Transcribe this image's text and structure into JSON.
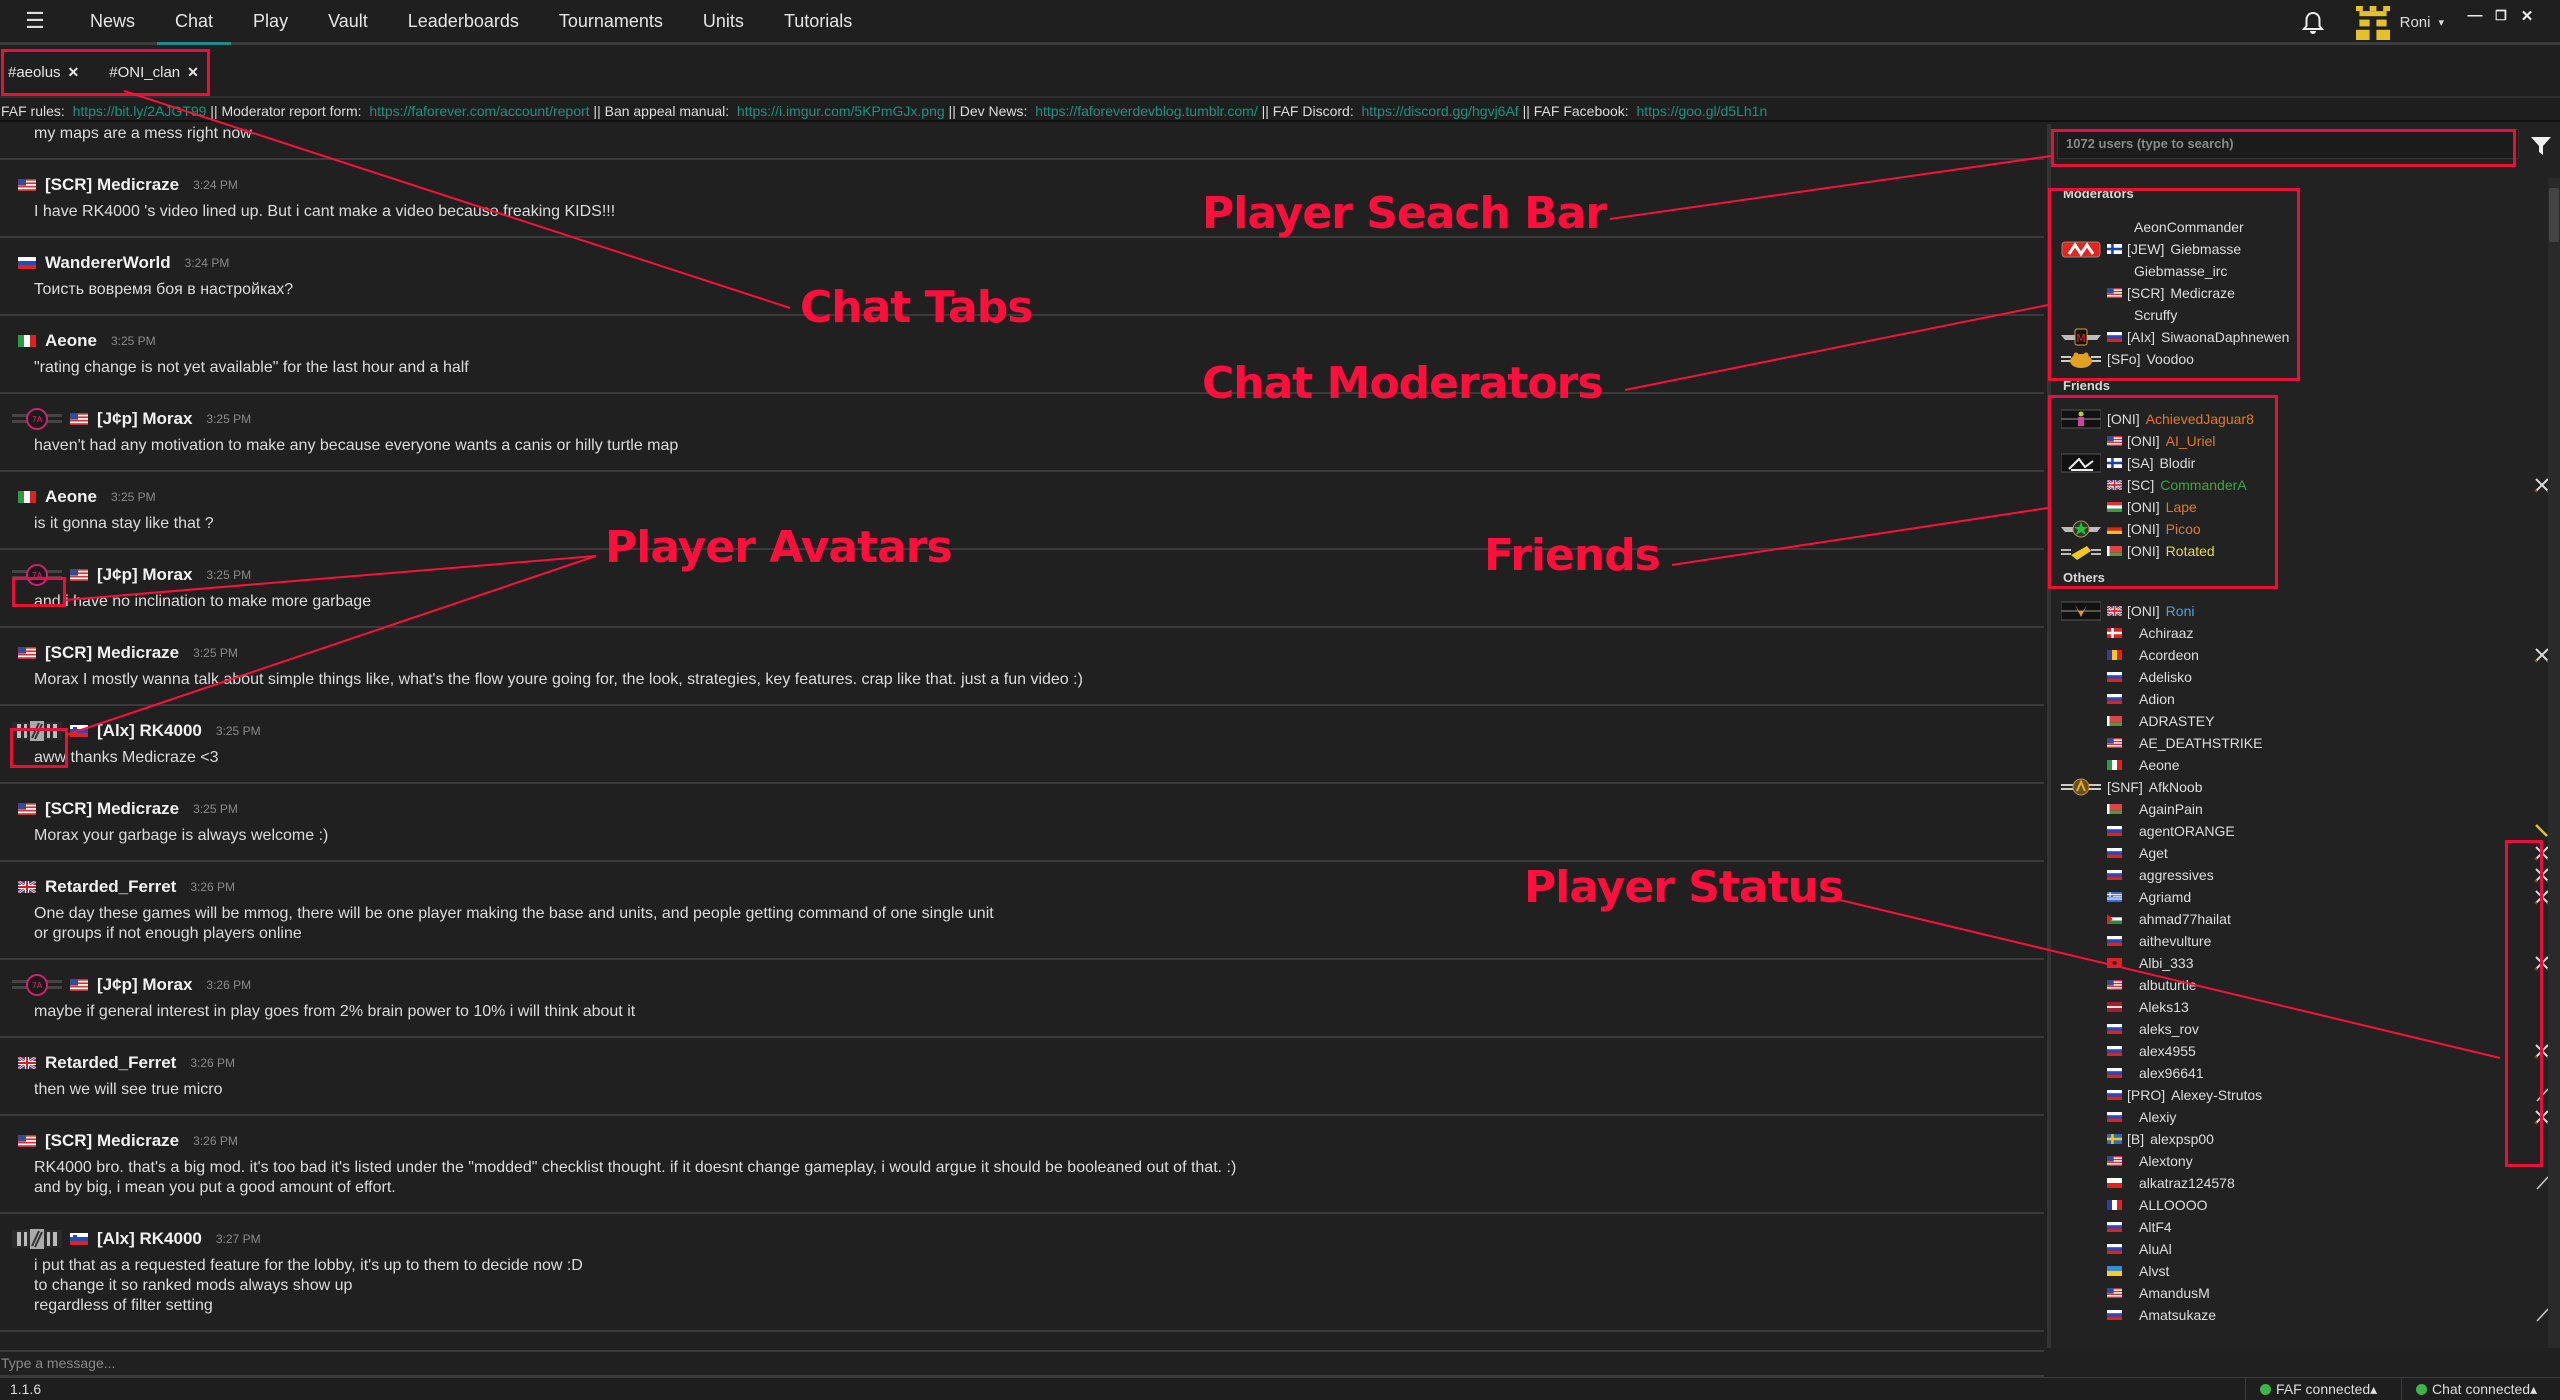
{
  "nav": {
    "menu_icon": "hamburger-icon",
    "items": [
      "News",
      "Chat",
      "Play",
      "Vault",
      "Leaderboards",
      "Tournaments",
      "Units",
      "Tutorials"
    ],
    "active": "Chat"
  },
  "user": {
    "name": "Roni",
    "caret": "▾"
  },
  "window": {
    "minimize": "—",
    "restore": "❐",
    "close": "✕"
  },
  "tabs": [
    {
      "label": "#aeolus",
      "close": "✕"
    },
    {
      "label": "#ONI_clan",
      "close": "✕"
    }
  ],
  "topic": {
    "parts": [
      {
        "text": "FAF rules:  ",
        "link": false
      },
      {
        "text": "https://bit.ly/2AJGT99",
        "link": true
      },
      {
        "text": " || Moderator report form:  ",
        "link": false
      },
      {
        "text": "https://faforever.com/account/report",
        "link": true
      },
      {
        "text": " || Ban appeal manual:  ",
        "link": false
      },
      {
        "text": "https://i.imgur.com/5KPmGJx.png",
        "link": true
      },
      {
        "text": " || Dev News:  ",
        "link": false
      },
      {
        "text": "https://faforeverdevblog.tumblr.com/",
        "link": true
      },
      {
        "text": " || FAF Discord:  ",
        "link": false
      },
      {
        "text": "https://discord.gg/hgvj6Af",
        "link": true
      },
      {
        "text": " || FAF Facebook:  ",
        "link": false
      },
      {
        "text": "https://goo.gl/d5Lh1n",
        "link": true
      }
    ]
  },
  "messages": [
    {
      "author": "",
      "time": "",
      "flag": "",
      "avatar": "",
      "body": "my maps are a mess right now",
      "partial": true
    },
    {
      "author": "[SCR] Medicraze",
      "time": "3:24 PM",
      "flag": "us",
      "avatar": "",
      "body": "I have RK4000 's video lined up. But i cant make a video because freaking KIDS!!!"
    },
    {
      "author": "WandererWorld",
      "time": "3:24 PM",
      "flag": "ru",
      "avatar": "",
      "body": "Тоисть вовремя боя в настройках?"
    },
    {
      "author": "Aeone",
      "time": "3:25 PM",
      "flag": "it",
      "avatar": "",
      "body": "\"rating change is not yet available\" for the last hour and a half"
    },
    {
      "author": "[J¢p] Morax",
      "time": "3:25 PM",
      "flag": "us",
      "avatar": "pink",
      "body": "haven't had any motivation to make any because everyone wants a canis or hilly turtle map"
    },
    {
      "author": "Aeone",
      "time": "3:25 PM",
      "flag": "it",
      "avatar": "",
      "body": "is it gonna stay like that ?"
    },
    {
      "author": "[J¢p] Morax",
      "time": "3:25 PM",
      "flag": "us",
      "avatar": "pink",
      "body": "and i have no inclination to make more garbage"
    },
    {
      "author": "[SCR] Medicraze",
      "time": "3:25 PM",
      "flag": "us",
      "avatar": "",
      "body": "Morax I mostly wanna talk about simple things like, what's the flow youre going for, the look, strategies, key features. crap like that. just a fun video :)"
    },
    {
      "author": "[Alx] RK4000",
      "time": "3:25 PM",
      "flag": "si",
      "avatar": "grey",
      "body": "aww thanks Medicraze <3"
    },
    {
      "author": "[SCR] Medicraze",
      "time": "3:25 PM",
      "flag": "us",
      "avatar": "",
      "body": "Morax your garbage is always welcome :)"
    },
    {
      "author": "Retarded_Ferret",
      "time": "3:26 PM",
      "flag": "gb",
      "avatar": "",
      "body": "One day these games will be mmog, there will be one player making the base and units, and people getting command of one single unit\nor groups if not enough players online"
    },
    {
      "author": "[J¢p] Morax",
      "time": "3:26 PM",
      "flag": "us",
      "avatar": "pink",
      "body": "maybe if general interest in play goes from 2% brain power to 10% i will think about it"
    },
    {
      "author": "Retarded_Ferret",
      "time": "3:26 PM",
      "flag": "gb",
      "avatar": "",
      "body": "then we will see true micro"
    },
    {
      "author": "[SCR] Medicraze",
      "time": "3:26 PM",
      "flag": "us",
      "avatar": "",
      "body": "RK4000 bro. that's a big mod. it's too bad it's listed under the \"modded\" checklist thought. if it doesnt change gameplay, i would argue it should be booleaned out of that. :)\nand by big, i mean you put a good amount of effort."
    },
    {
      "author": "[Alx] RK4000",
      "time": "3:27 PM",
      "flag": "si",
      "avatar": "grey",
      "body": "i put that as a requested feature for the lobby, it's up to them to decide now :D\nto change it so ranked mods always show up\nregardless of filter setting"
    }
  ],
  "message_input": {
    "placeholder": "Type a message..."
  },
  "statusbar": {
    "version": "1.1.6",
    "faf": "FAF connected▴",
    "chat": "Chat connected▴",
    "status_color": "#3cb44a"
  },
  "userlist": {
    "search_placeholder": "1072 users (type to search)",
    "filter_icon": "filter-icon",
    "sections": [
      {
        "title": "Moderators",
        "users": [
          {
            "clan": "",
            "name": "AeonCommander",
            "flag": "",
            "avatar": "",
            "color": "#dedede",
            "status": ""
          },
          {
            "clan": "[JEW]",
            "name": "Giebmasse",
            "flag": "fi",
            "avatar": "red-m",
            "color": "#dedede",
            "status": ""
          },
          {
            "clan": "",
            "name": "Giebmasse_irc",
            "flag": "",
            "avatar": "",
            "color": "#dedede",
            "status": ""
          },
          {
            "clan": "[SCR]",
            "name": "Medicraze",
            "flag": "us",
            "avatar": "",
            "color": "#dedede",
            "status": ""
          },
          {
            "clan": "",
            "name": "Scruffy",
            "flag": "",
            "avatar": "",
            "color": "#dedede",
            "status": ""
          },
          {
            "clan": "[AIx]",
            "name": "SiwaonaDaphnewen",
            "flag": "ru",
            "avatar": "mod-wings",
            "color": "#dedede",
            "status": ""
          },
          {
            "clan": "[SFo]",
            "name": "Voodoo",
            "flag": "none",
            "avatar": "frog",
            "color": "#dedede",
            "status": ""
          }
        ]
      },
      {
        "title": "Friends",
        "users": [
          {
            "clan": "[ONI]",
            "name": "AchievedJaguar8",
            "flag": "none",
            "avatar": "person",
            "color": "#e07a1f",
            "status": ""
          },
          {
            "clan": "[ONI]",
            "name": "AI_Uriel",
            "flag": "us",
            "avatar": "",
            "color": "#e07a1f",
            "status": ""
          },
          {
            "clan": "[SA]",
            "name": "Blodir",
            "flag": "fi",
            "avatar": "sketch",
            "color": "#dedede",
            "status": ""
          },
          {
            "clan": "[SC]",
            "name": "CommanderA",
            "flag": "gb",
            "avatar": "",
            "color": "#3fa34d",
            "status": "playing"
          },
          {
            "clan": "[ONI]",
            "name": "Lape",
            "flag": "hu",
            "avatar": "",
            "color": "#e07a1f",
            "status": ""
          },
          {
            "clan": "[ONI]",
            "name": "Picoo",
            "flag": "de",
            "avatar": "star-wings",
            "color": "#e07a1f",
            "status": ""
          },
          {
            "clan": "[ONI]",
            "name": "Rotated",
            "flag": "by",
            "avatar": "whistle",
            "color": "#e6d84a",
            "status": ""
          }
        ]
      },
      {
        "title": "Others",
        "users": [
          {
            "clan": "[ONI]",
            "name": "Roni",
            "flag": "gb",
            "avatar": "gold",
            "color": "#4aa3e0",
            "status": ""
          },
          {
            "clan": "",
            "name": "Achiraaz",
            "flag": "dk",
            "avatar": "",
            "color": "#dedede",
            "status": ""
          },
          {
            "clan": "",
            "name": "Acordeon",
            "flag": "ro",
            "avatar": "",
            "color": "#dedede",
            "status": "playing"
          },
          {
            "clan": "",
            "name": "Adelisko",
            "flag": "ru",
            "avatar": "",
            "color": "#dedede",
            "status": ""
          },
          {
            "clan": "",
            "name": "Adion",
            "flag": "ru",
            "avatar": "",
            "color": "#dedede",
            "status": ""
          },
          {
            "clan": "",
            "name": "ADRASTEY",
            "flag": "by",
            "avatar": "",
            "color": "#dedede",
            "status": ""
          },
          {
            "clan": "",
            "name": "AE_DEATHSTRIKE",
            "flag": "us",
            "avatar": "",
            "color": "#dedede",
            "status": ""
          },
          {
            "clan": "",
            "name": "Aeone",
            "flag": "it",
            "avatar": "",
            "color": "#dedede",
            "status": ""
          },
          {
            "clan": "[SNF]",
            "name": "AfkNoob",
            "flag": "none",
            "avatar": "gold-wings",
            "color": "#dedede",
            "status": ""
          },
          {
            "clan": "",
            "name": "AgainPain",
            "flag": "by",
            "avatar": "",
            "color": "#dedede",
            "status": ""
          },
          {
            "clan": "",
            "name": "agentORANGE",
            "flag": "ru",
            "avatar": "",
            "color": "#dedede",
            "status": "hosting"
          },
          {
            "clan": "",
            "name": "Aget",
            "flag": "ru",
            "avatar": "",
            "color": "#dedede",
            "status": "playing"
          },
          {
            "clan": "",
            "name": "aggressives",
            "flag": "ru",
            "avatar": "",
            "color": "#dedede",
            "status": "playing"
          },
          {
            "clan": "",
            "name": "Agriamd",
            "flag": "gr",
            "avatar": "",
            "color": "#dedede",
            "status": "playing"
          },
          {
            "clan": "",
            "name": "ahmad77hailat",
            "flag": "jo",
            "avatar": "",
            "color": "#dedede",
            "status": ""
          },
          {
            "clan": "",
            "name": "aithevulture",
            "flag": "ru",
            "avatar": "",
            "color": "#dedede",
            "status": ""
          },
          {
            "clan": "",
            "name": "Albi_333",
            "flag": "al",
            "avatar": "",
            "color": "#dedede",
            "status": "playing"
          },
          {
            "clan": "",
            "name": "albuturtle",
            "flag": "us",
            "avatar": "",
            "color": "#dedede",
            "status": ""
          },
          {
            "clan": "",
            "name": "Aleks13",
            "flag": "lv",
            "avatar": "",
            "color": "#dedede",
            "status": ""
          },
          {
            "clan": "",
            "name": "aleks_rov",
            "flag": "ru",
            "avatar": "",
            "color": "#dedede",
            "status": ""
          },
          {
            "clan": "",
            "name": "alex4955",
            "flag": "ru",
            "avatar": "",
            "color": "#dedede",
            "status": "playing"
          },
          {
            "clan": "",
            "name": "alex96641",
            "flag": "ru",
            "avatar": "",
            "color": "#dedede",
            "status": ""
          },
          {
            "clan": "[PRO]",
            "name": "Alexey-Strutos",
            "flag": "ru",
            "avatar": "",
            "color": "#dedede",
            "status": "lobby"
          },
          {
            "clan": "",
            "name": "Alexiy",
            "flag": "ru",
            "avatar": "",
            "color": "#dedede",
            "status": "playing"
          },
          {
            "clan": "[B]",
            "name": "alexpsp00",
            "flag": "se",
            "avatar": "",
            "color": "#dedede",
            "status": ""
          },
          {
            "clan": "",
            "name": "Alextony",
            "flag": "us",
            "avatar": "",
            "color": "#dedede",
            "status": ""
          },
          {
            "clan": "",
            "name": "alkatraz124578",
            "flag": "pl",
            "avatar": "",
            "color": "#dedede",
            "status": "lobby"
          },
          {
            "clan": "",
            "name": "ALLOOOO",
            "flag": "fr",
            "avatar": "",
            "color": "#dedede",
            "status": ""
          },
          {
            "clan": "",
            "name": "AltF4",
            "flag": "ru",
            "avatar": "",
            "color": "#dedede",
            "status": ""
          },
          {
            "clan": "",
            "name": "AluAl",
            "flag": "ru",
            "avatar": "",
            "color": "#dedede",
            "status": ""
          },
          {
            "clan": "",
            "name": "Alvst",
            "flag": "ua",
            "avatar": "",
            "color": "#dedede",
            "status": ""
          },
          {
            "clan": "",
            "name": "AmandusM",
            "flag": "us",
            "avatar": "",
            "color": "#dedede",
            "status": ""
          },
          {
            "clan": "",
            "name": "Amatsukaze",
            "flag": "ru",
            "avatar": "",
            "color": "#dedede",
            "status": "lobby"
          }
        ]
      }
    ]
  },
  "annotations": {
    "chat_tabs": "Chat Tabs",
    "search_bar": "Player Seach Bar",
    "moderators": "Chat Moderators",
    "avatars": "Player Avatars",
    "friends": "Friends",
    "status": "Player Status",
    "color": "#ff0f3c"
  }
}
